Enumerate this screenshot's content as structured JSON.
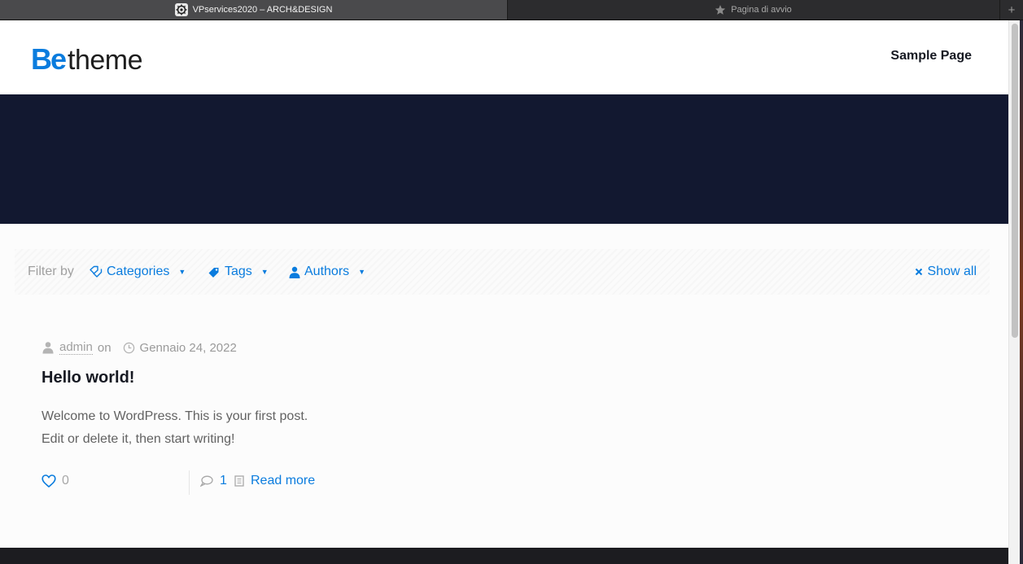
{
  "browser": {
    "tabs": [
      {
        "title": "VPservices2020 – ARCH&DESIGN",
        "active": true,
        "icon": "gear-icon"
      },
      {
        "title": "Pagina di avvio",
        "active": false,
        "icon": "star-icon"
      }
    ],
    "new_tab_label": "+"
  },
  "header": {
    "logo": {
      "be": "Be",
      "theme": "theme"
    },
    "nav": [
      "Sample Page"
    ]
  },
  "filters": {
    "label": "Filter by",
    "items": [
      {
        "label": "Categories",
        "icon": "categories-icon"
      },
      {
        "label": "Tags",
        "icon": "tag-icon"
      },
      {
        "label": "Authors",
        "icon": "user-icon"
      }
    ],
    "show_all": "Show all"
  },
  "post": {
    "author": "admin",
    "on": "on",
    "date": "Gennaio 24, 2022",
    "title": "Hello world!",
    "excerpt_line1": "Welcome to WordPress. This is your first post.",
    "excerpt_line2": "Edit or delete it, then start writing!",
    "likes": "0",
    "comments": "1",
    "read_more": "Read more"
  },
  "colors": {
    "accent": "#0a7cde",
    "hero_bg": "#121830",
    "heading": "#161922",
    "text": "#626262"
  }
}
